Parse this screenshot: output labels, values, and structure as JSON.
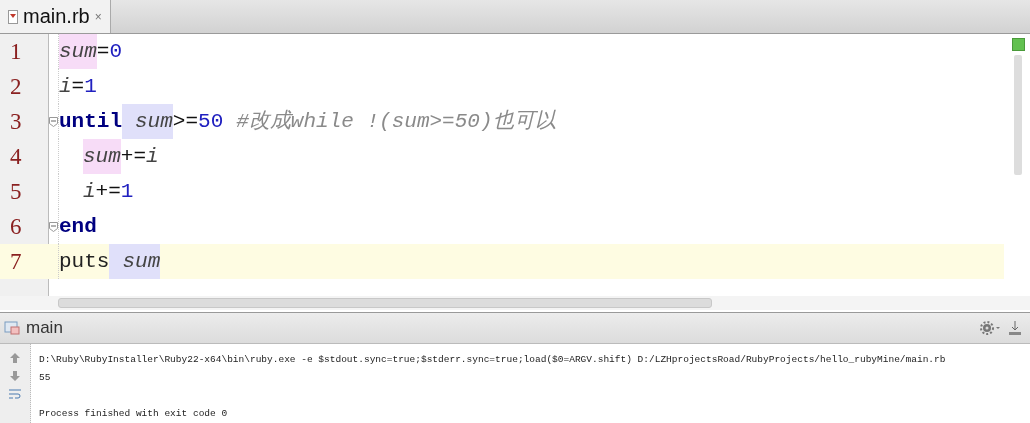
{
  "tabs": [
    {
      "label": "main.rb",
      "selected": true,
      "close": "×"
    }
  ],
  "editor": {
    "lines": [
      {
        "number": "1",
        "fold": false,
        "current": false,
        "tokens": [
          {
            "kind": "var_write",
            "text": "sum"
          },
          {
            "kind": "op",
            "text": "="
          },
          {
            "kind": "num",
            "text": "0"
          }
        ]
      },
      {
        "number": "2",
        "fold": false,
        "current": false,
        "tokens": [
          {
            "kind": "var",
            "text": "i"
          },
          {
            "kind": "op",
            "text": "="
          },
          {
            "kind": "num",
            "text": "1"
          }
        ]
      },
      {
        "number": "3",
        "fold": true,
        "current": false,
        "tokens": [
          {
            "kind": "keyword",
            "text": "until"
          },
          {
            "kind": "var_read",
            "text": "sum",
            "space_before": true
          },
          {
            "kind": "op",
            "text": ">="
          },
          {
            "kind": "num",
            "text": "50"
          },
          {
            "kind": "comment",
            "text": "#改成while !(sum>=50)也可以",
            "space_before": true
          }
        ],
        "children": [
          {
            "number": "4",
            "fold": false,
            "current": false,
            "tokens": [
              {
                "kind": "var_write",
                "text": "sum"
              },
              {
                "kind": "op",
                "text": "+="
              },
              {
                "kind": "var",
                "text": "i"
              }
            ]
          },
          {
            "number": "5",
            "fold": false,
            "current": false,
            "tokens": [
              {
                "kind": "var",
                "text": "i"
              },
              {
                "kind": "op",
                "text": "+="
              },
              {
                "kind": "num",
                "text": "1"
              }
            ]
          }
        ]
      },
      {
        "number": "6",
        "fold": true,
        "current": false,
        "tokens": [
          {
            "kind": "keyword",
            "text": "end"
          }
        ]
      },
      {
        "number": "7",
        "fold": false,
        "current": true,
        "tokens": [
          {
            "kind": "ident",
            "text": "puts"
          },
          {
            "kind": "var_read",
            "text": "sum",
            "space_before": true
          }
        ]
      }
    ]
  },
  "run_panel": {
    "title": "main",
    "console": [
      {
        "text": "D:\\Ruby\\RubyInstaller\\Ruby22-x64\\bin\\ruby.exe -e $stdout.sync=true;$stderr.sync=true;load($0=ARGV.shift) D:/LZHprojectsRoad/RubyProjects/hello_rubyMine/main.rb",
        "gap_before": false
      },
      {
        "text": "55",
        "gap_before": false
      },
      {
        "text": "Process finished with exit code 0",
        "gap_before": true
      }
    ]
  }
}
